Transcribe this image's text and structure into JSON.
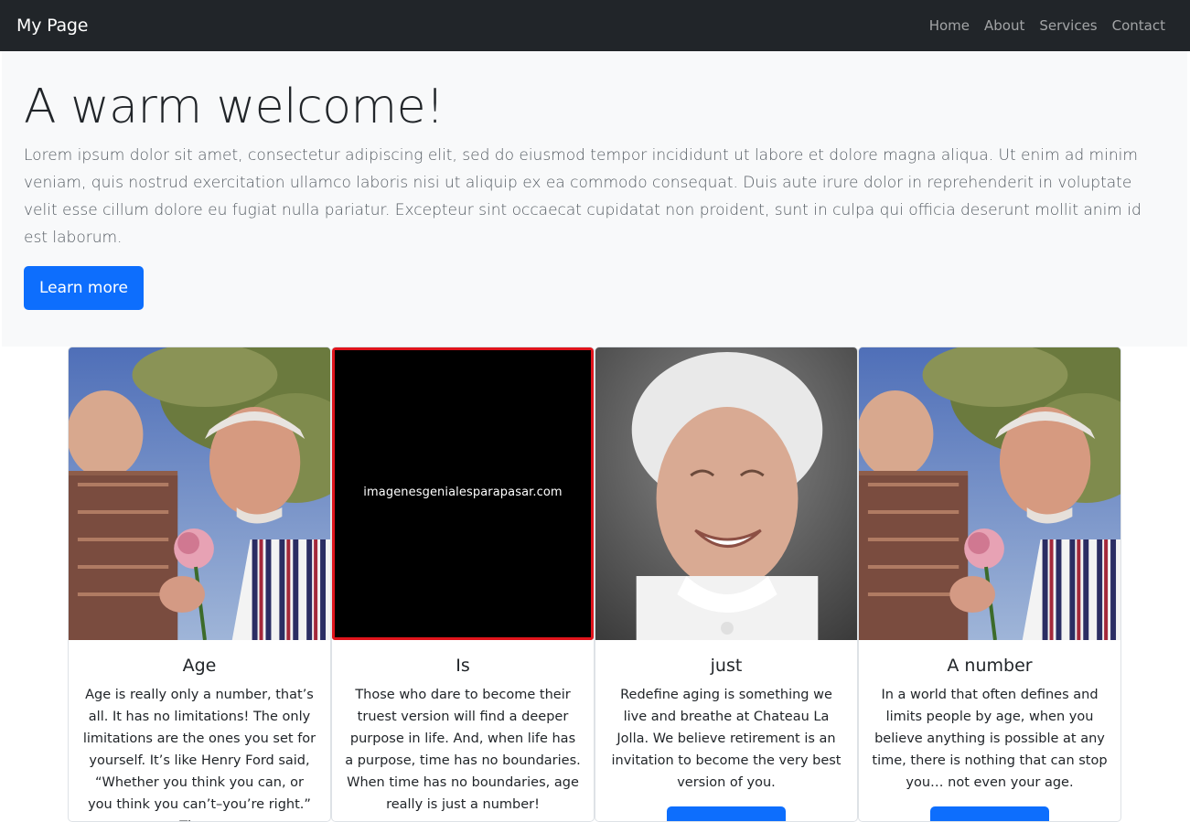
{
  "navbar": {
    "brand": "My Page",
    "links": [
      "Home",
      "About",
      "Services",
      "Contact"
    ]
  },
  "hero": {
    "title": "A warm welcome!",
    "text": "Lorem ipsum dolor sit amet, consectetur adipiscing elit, sed do eiusmod tempor incididunt ut labore et dolore magna aliqua. Ut enim ad minim veniam, quis nostrud exercitation ullamco laboris nisi ut aliquip ex ea commodo consequat. Duis aute irure dolor in reprehenderit in voluptate velit esse cillum dolore eu fugiat nulla pariatur. Excepteur sint occaecat cupidatat non proident, sunt in culpa qui officia deserunt mollit anim id est laborum.",
    "button_label": "Learn more"
  },
  "cards": [
    {
      "title": "Age",
      "text": "Age is really only a number, that’s all. It has no limitations! The only limitations are the ones you set for yourself. It’s like Henry Ford said, “Whether you think you can, or you think you can’t–you’re right.” Those"
    },
    {
      "title": "Is",
      "image_text": "imagenesgenialesparapasar.com",
      "text": "Those who dare to become their truest version will find a deeper purpose in life. And, when life has a purpose, time has no boundaries. When time has no boundaries, age really is just a number!"
    },
    {
      "title": "just",
      "text": "Redefine aging is something we live and breathe at Chateau La Jolla. We believe retirement is an invitation to become the very best version of you."
    },
    {
      "title": "A number",
      "text": "In a world that often defines and limits people by age, when you believe anything is possible at any time, there is nothing that can stop you… not even your age."
    }
  ],
  "colors": {
    "navbar": "#212529",
    "hero_bg": "#f8f9fa",
    "primary": "#0d6efd",
    "image_border": "#e0141c"
  }
}
